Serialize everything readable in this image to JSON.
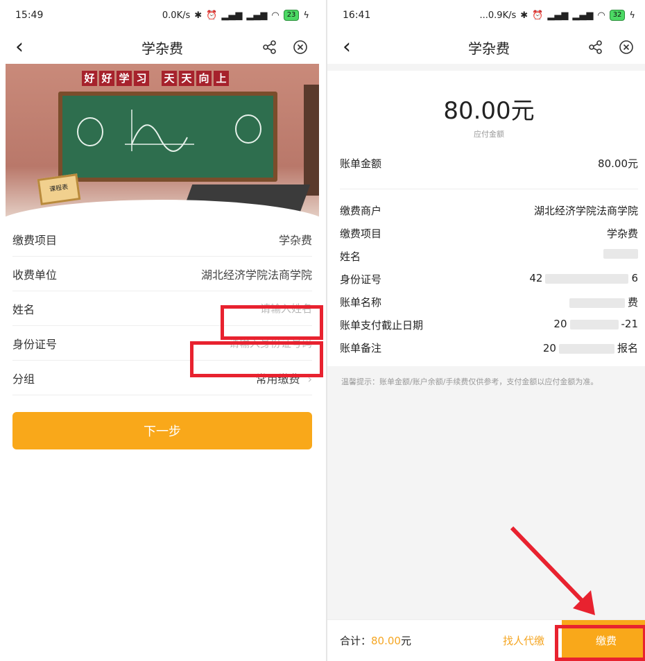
{
  "left": {
    "status": {
      "time": "15:49",
      "net": "0.0K/s",
      "battery": "23"
    },
    "nav": {
      "back": "‹",
      "title": "学杂费",
      "share_icon": "share-icon",
      "close_icon": "mini-program-close-icon"
    },
    "banner": {
      "slogan_1": [
        "好",
        "好",
        "学",
        "习"
      ],
      "slogan_2": [
        "天",
        "天",
        "向",
        "上"
      ],
      "sign": "课程表"
    },
    "form": {
      "rows": [
        {
          "label": "缴费项目",
          "value": "学杂费"
        },
        {
          "label": "收费单位",
          "value": "湖北经济学院法商学院"
        },
        {
          "label": "姓名",
          "placeholder": "请输入姓名"
        },
        {
          "label": "身份证号",
          "placeholder": "请输入身份证号码"
        },
        {
          "label": "分组",
          "value": "常用缴费",
          "chevron": "›"
        }
      ]
    },
    "next_button": "下一步"
  },
  "right": {
    "status": {
      "time": "16:41",
      "net": "...0.9K/s",
      "battery": "32"
    },
    "nav": {
      "back": "‹",
      "title": "学杂费"
    },
    "amount": "80.00元",
    "amount_label": "应付金额",
    "bill": {
      "label": "账单金额",
      "value": "80.00元"
    },
    "details": [
      {
        "label": "缴费商户",
        "value": "湖北经济学院法商学院"
      },
      {
        "label": "缴费项目",
        "value": "学杂费"
      },
      {
        "label": "姓名",
        "value": ""
      },
      {
        "label": "身份证号",
        "value": "42",
        "tail": "6"
      },
      {
        "label": "账单名称",
        "value": "",
        "tail": "费"
      },
      {
        "label": "账单支付截止日期",
        "value": "20",
        "tail": "-21"
      },
      {
        "label": "账单备注",
        "value": "20",
        "tail": "报名"
      }
    ],
    "tip": "温馨提示：账单金额/账户余额/手续费仅供参考，支付金额以应付金额为准。",
    "footer": {
      "total_label": "合计：",
      "total_value": "80.00",
      "total_unit": "元",
      "helper": "找人代缴",
      "pay": "缴费"
    }
  },
  "colors": {
    "accent": "#f9a81a",
    "highlight": "#e8222f",
    "board": "#2e6e4e"
  }
}
